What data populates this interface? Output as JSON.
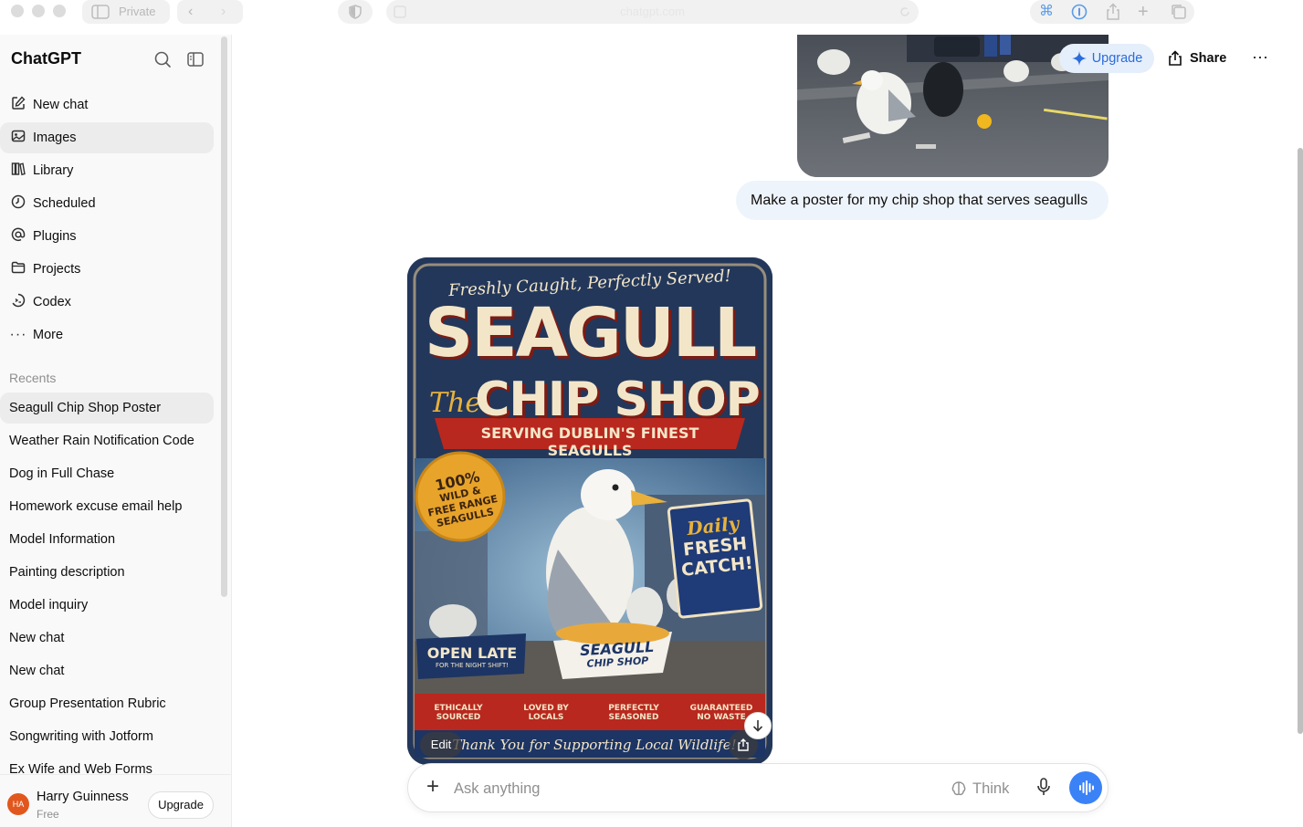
{
  "browser": {
    "private_label": "Private",
    "url": "chatgpt.com"
  },
  "sidebar": {
    "brand": "ChatGPT",
    "nav": [
      {
        "label": "New chat",
        "icon": "compose-icon"
      },
      {
        "label": "Images",
        "icon": "images-icon"
      },
      {
        "label": "Library",
        "icon": "library-icon"
      },
      {
        "label": "Scheduled",
        "icon": "clock-icon"
      },
      {
        "label": "Plugins",
        "icon": "at-icon"
      },
      {
        "label": "Projects",
        "icon": "folder-icon"
      },
      {
        "label": "Codex",
        "icon": "codex-icon"
      },
      {
        "label": "More",
        "icon": "ellipsis-icon"
      }
    ],
    "recents_title": "Recents",
    "recents": [
      "Seagull Chip Shop Poster",
      "Weather Rain Notification Code",
      "Dog in Full Chase",
      "Homework excuse email help",
      "Model Information",
      "Painting description",
      "Model inquiry",
      "New chat",
      "New chat",
      "Group Presentation Rubric",
      "Songwriting with Jotform",
      "Ex Wife and Web Forms"
    ],
    "user": {
      "initials": "HA",
      "name": "Harry Guinness",
      "plan": "Free",
      "upgrade_label": "Upgrade"
    }
  },
  "header": {
    "upgrade_label": "Upgrade",
    "share_label": "Share"
  },
  "chat": {
    "user_message": "Make a poster for my chip shop that serves seagulls",
    "poster": {
      "tagline": "Freshly Caught, Perfectly Served!",
      "title_line1": "SEAGULL",
      "title_prefix": "The",
      "title_line2": "CHIP SHOP",
      "banner": "SERVING DUBLIN'S FINEST SEAGULLS",
      "badge": [
        "100%",
        "WILD &",
        "FREE RANGE",
        "SEAGULLS"
      ],
      "sign": [
        "Daily",
        "FRESH",
        "CATCH!"
      ],
      "open_late": "OPEN LATE",
      "open_late_sub": "FOR THE NIGHT SHIFT!",
      "box_label_1": "SEAGULL",
      "box_label_2": "CHIP SHOP",
      "features": [
        "ETHICALLY SOURCED",
        "LOVED BY LOCALS",
        "PERFECTLY SEASONED",
        "GUARANTEED NO WASTE"
      ],
      "footer": "Thank You for Supporting Local Wildlife!"
    },
    "edit_label": "Edit"
  },
  "composer": {
    "placeholder": "Ask anything",
    "think_label": "Think"
  },
  "colors": {
    "accent_blue": "#3b82f6",
    "upgrade_bg": "#e5eefb",
    "bubble_bg": "#eef4fb",
    "poster_red": "#b8281e",
    "poster_navy": "#24385c",
    "poster_cream": "#f3e6c8",
    "badge_orange": "#e8a32a"
  }
}
